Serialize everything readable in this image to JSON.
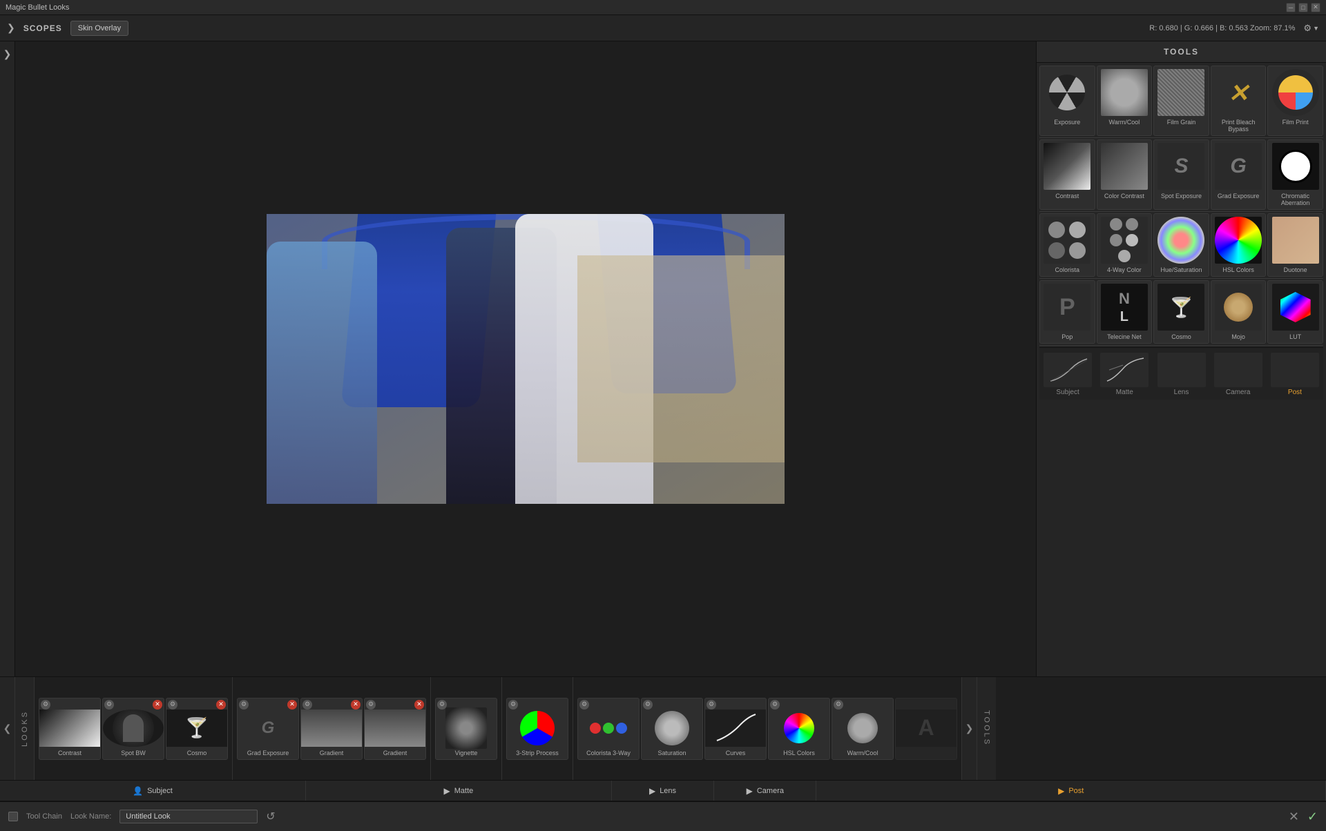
{
  "app": {
    "title": "Magic Bullet Looks",
    "window_controls": [
      "minimize",
      "maximize",
      "close"
    ]
  },
  "topbar": {
    "nav_arrow": "❯",
    "scopes_label": "SCOPES",
    "skin_overlay_btn": "Skin Overlay",
    "color_info": "R: 0.680  |  G: 0.666  |  B: 0.563    Zoom: 87.1%",
    "settings_icon": "⚙"
  },
  "tools_panel": {
    "header": "TOOLS",
    "rows": [
      [
        {
          "id": "exposure",
          "label": "Exposure"
        },
        {
          "id": "warmcool",
          "label": "Warm/Cool"
        },
        {
          "id": "filmgrain",
          "label": "Film Grain"
        },
        {
          "id": "printbleach",
          "label": "Print Bleach Bypass"
        },
        {
          "id": "filmprint",
          "label": "Film Print"
        }
      ],
      [
        {
          "id": "contrast",
          "label": "Contrast"
        },
        {
          "id": "colorcontrast",
          "label": "Color Contrast"
        },
        {
          "id": "spotexposure",
          "label": "Spot Exposure"
        },
        {
          "id": "gradexposure",
          "label": "Grad Exposure"
        },
        {
          "id": "chromaticaberration",
          "label": "Chromatic Aberration"
        }
      ],
      [
        {
          "id": "colorista",
          "label": "Colorista"
        },
        {
          "id": "fourwaycolor",
          "label": "4-Way Color"
        },
        {
          "id": "huesaturation",
          "label": "Hue/Saturation"
        },
        {
          "id": "hslcolors",
          "label": "HSL Colors"
        },
        {
          "id": "duotone",
          "label": "Duotone"
        }
      ],
      [
        {
          "id": "pop",
          "label": "Pop"
        },
        {
          "id": "telecinenet",
          "label": "Telecine Net"
        },
        {
          "id": "cosmo",
          "label": "Cosmo"
        },
        {
          "id": "mojo",
          "label": "Mojo"
        },
        {
          "id": "lut",
          "label": "LUT"
        }
      ]
    ],
    "segment_tabs": [
      {
        "id": "subject",
        "label": "Subject",
        "active": false
      },
      {
        "id": "matte",
        "label": "Matte",
        "active": false
      },
      {
        "id": "lens",
        "label": "Lens",
        "active": false
      },
      {
        "id": "camera",
        "label": "Camera",
        "active": false
      },
      {
        "id": "post",
        "label": "Post",
        "active": true
      }
    ]
  },
  "bottom_strip": {
    "sections": [
      {
        "label": "Subject",
        "items": [
          {
            "id": "contrast_strip",
            "label": "Contrast"
          },
          {
            "id": "spot_strip",
            "label": "Spot BW"
          },
          {
            "id": "cosmo_strip",
            "label": "Cosmo"
          }
        ]
      },
      {
        "label": "Matte",
        "items": [
          {
            "id": "grad_strip",
            "label": "Grad Exposure"
          },
          {
            "id": "gradient_strip",
            "label": "Gradient"
          },
          {
            "id": "gradient2_strip",
            "label": "Gradient"
          }
        ]
      },
      {
        "label": "Lens",
        "items": [
          {
            "id": "vignette_strip",
            "label": "Vignette"
          }
        ]
      },
      {
        "label": "Camera",
        "items": [
          {
            "id": "threestrip_strip",
            "label": "3-Strip Process"
          }
        ]
      },
      {
        "label": "Post",
        "items": [
          {
            "id": "colorista3_strip",
            "label": "Colorista 3-Way"
          },
          {
            "id": "saturation_strip",
            "label": "Saturation"
          },
          {
            "id": "curves_strip",
            "label": "Curves"
          },
          {
            "id": "hslcolors_strip",
            "label": "HSL Colors"
          },
          {
            "id": "warmcool_strip",
            "label": "Warm/Cool"
          }
        ]
      }
    ],
    "section_labels": [
      {
        "id": "subject_label",
        "text": "Subject"
      },
      {
        "id": "matte_label",
        "text": "Matte"
      },
      {
        "id": "lens_label",
        "text": "Lens"
      },
      {
        "id": "camera_label",
        "text": "Camera"
      },
      {
        "id": "post_label",
        "text": "Post"
      }
    ]
  },
  "toolchain": {
    "label": "Tool Chain",
    "look_name_label": "Look Name:",
    "look_name_value": "Untitled Look",
    "reset_icon": "↺",
    "cancel_icon": "✕",
    "ok_icon": "✓"
  }
}
